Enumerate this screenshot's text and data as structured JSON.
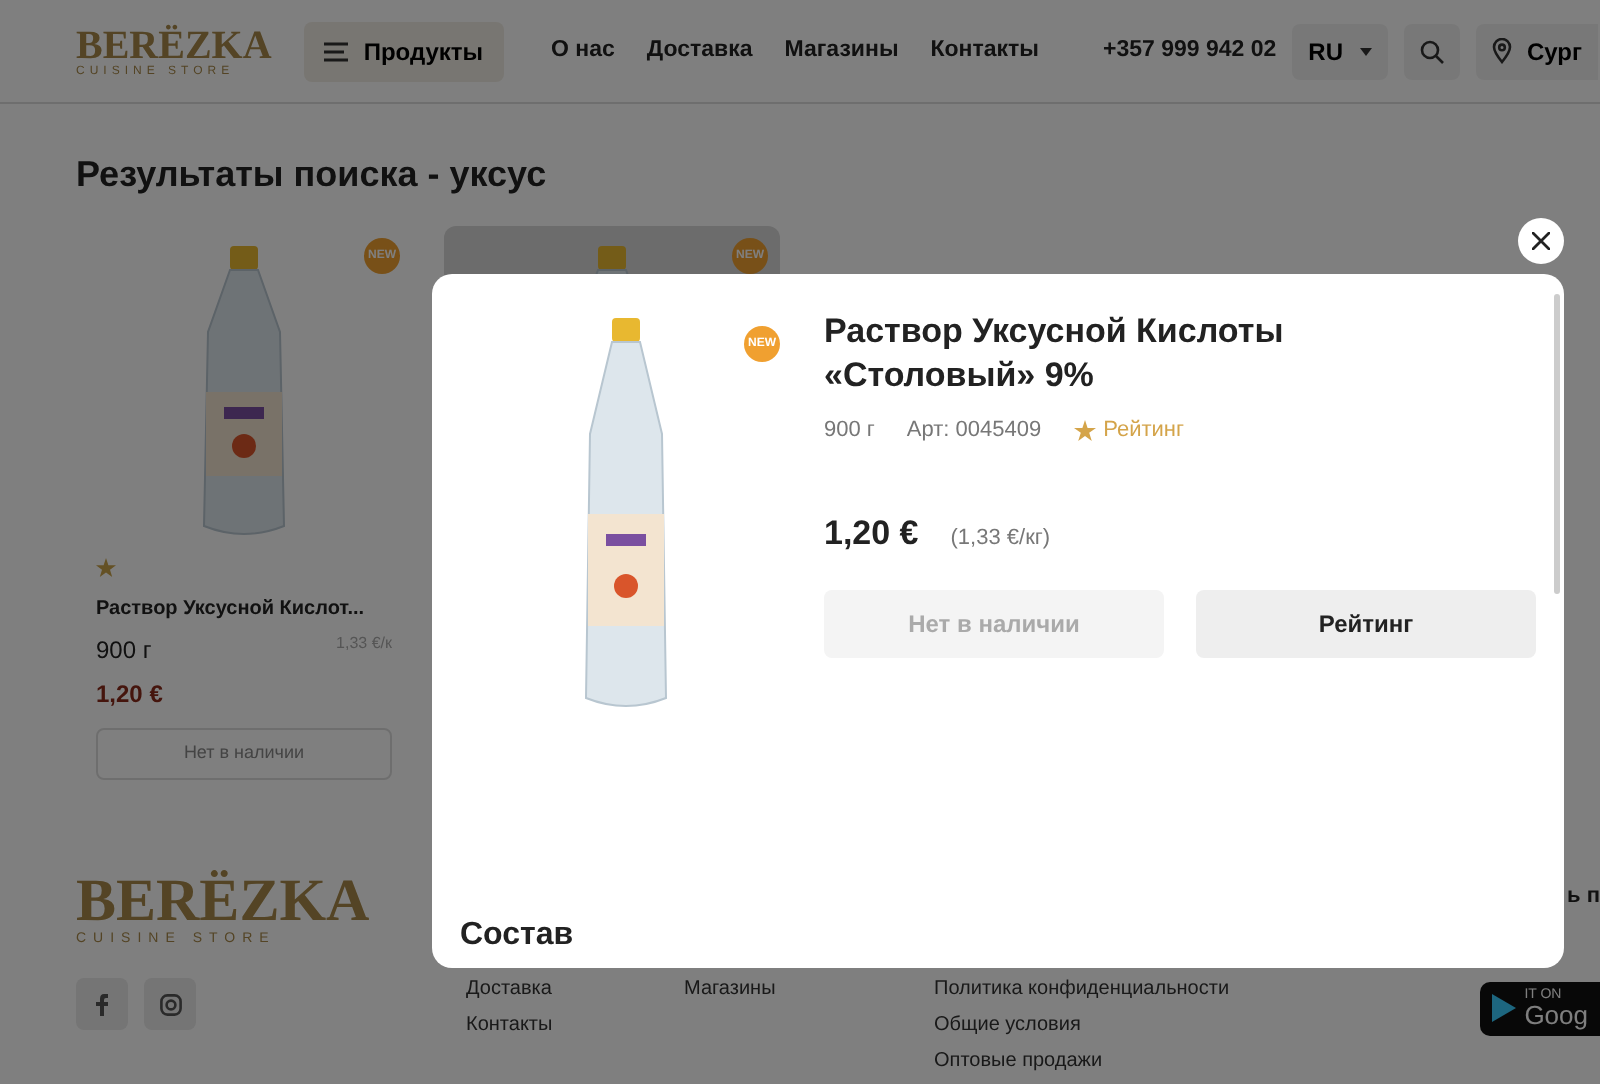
{
  "header": {
    "logo": {
      "name": "BERЁZKA",
      "tagline": "CUISINE STORE"
    },
    "menu_button": "Продукты",
    "nav": [
      "О нас",
      "Доставка",
      "Магазины",
      "Контакты"
    ],
    "phone": "+357 999 942 02",
    "language": "RU",
    "location": "Сург"
  },
  "page_title": "Результаты поиска - уксус",
  "products": [
    {
      "badge": "NEW",
      "hovered": false,
      "name": "Раствор Уксусной Кислот...",
      "weight": "900 г",
      "unit_price": "1,33 €/к",
      "price": "1,20 €",
      "button": "Нет в наличии"
    },
    {
      "badge": "NEW",
      "hovered": true
    }
  ],
  "modal": {
    "badge": "NEW",
    "title": "Раствор Уксусной Кислоты «Столовый» 9%",
    "weight": "900 г",
    "article": "Арт: 0045409",
    "rating": "Рейтинг",
    "price": "1,20 €",
    "unit_price": "(1,33 €/кг)",
    "buttons": [
      {
        "label": "Нет в наличии",
        "disabled": true
      },
      {
        "label": "Рейтинг",
        "disabled": false
      }
    ],
    "section": "Состав"
  },
  "footer": {
    "logo": {
      "name": "BERЁZKA",
      "tagline": "CUISINE STORE"
    },
    "columns": [
      [
        "Доставка",
        "Контакты"
      ],
      [
        "Магазины"
      ],
      [
        "Политика конфиденциальности",
        "Общие условия",
        "Оптовые продажи"
      ]
    ],
    "heading_cut": "ь п",
    "app_badge": [
      "IT ON",
      "Goog"
    ]
  }
}
